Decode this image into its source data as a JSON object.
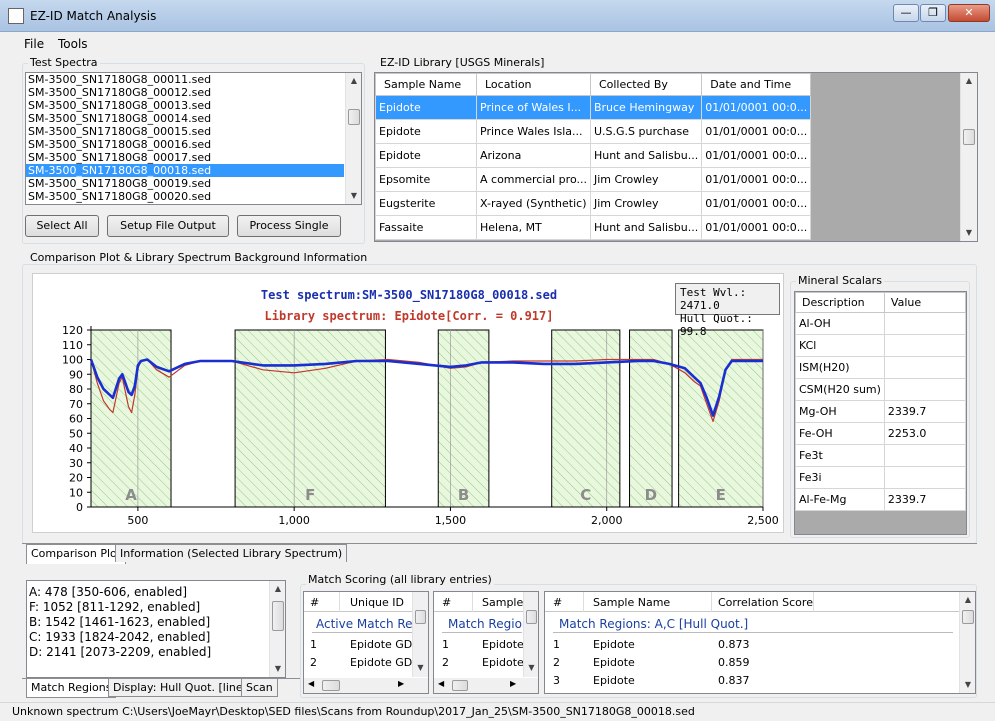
{
  "window": {
    "title": "EZ-ID Match Analysis",
    "min": "—",
    "max": "❐",
    "close": "✕"
  },
  "menu": [
    "File",
    "Tools"
  ],
  "test_spectra": {
    "label": "Test Spectra",
    "items": [
      "SM-3500_SN17180G8_00011.sed",
      "SM-3500_SN17180G8_00012.sed",
      "SM-3500_SN17180G8_00013.sed",
      "SM-3500_SN17180G8_00014.sed",
      "SM-3500_SN17180G8_00015.sed",
      "SM-3500_SN17180G8_00016.sed",
      "SM-3500_SN17180G8_00017.sed",
      "SM-3500_SN17180G8_00018.sed",
      "SM-3500_SN17180G8_00019.sed",
      "SM-3500_SN17180G8_00020.sed"
    ],
    "selected_index": 7,
    "buttons": {
      "select_all": "Select All",
      "setup": "Setup File Output",
      "process": "Process Single"
    }
  },
  "library": {
    "label": "EZ-ID Library [USGS Minerals]",
    "columns": [
      "Sample Name",
      "Location",
      "Collected By",
      "Date and Time"
    ],
    "rows": [
      [
        "Epidote",
        "Prince of Wales I...",
        "Bruce Hemingway",
        "01/01/0001 00:0..."
      ],
      [
        "Epidote",
        "Prince Wales Isla...",
        "U.S.G.S purchase",
        "01/01/0001 00:0..."
      ],
      [
        "Epidote",
        "Arizona",
        "Hunt and Salisbu...",
        "01/01/0001 00:0..."
      ],
      [
        "Epsomite",
        "A commercial pro...",
        "Jim Crowley",
        "01/01/0001 00:0..."
      ],
      [
        "Eugsterite",
        "X-rayed (Synthetic)",
        "Jim Crowley",
        "01/01/0001 00:0..."
      ],
      [
        "Fassaite",
        "Helena, MT",
        "Hunt and Salisbu...",
        "01/01/0001 00:0..."
      ]
    ],
    "selected_row": 0
  },
  "comparison": {
    "label": "Comparison Plot & Library Spectrum Background Information",
    "test_title": "Test spectrum:SM-3500_SN17180G8_00018.sed",
    "lib_title": "Library spectrum: Epidote[Corr. = 0.917]",
    "tooltip_line1": "Test Wvl.: 2471.0",
    "tooltip_line2": "Hull Quot.: 99.8",
    "colors": {
      "test": "#1a2fd0",
      "library": "#c0392b",
      "region_fill": "#e9f7df",
      "hatch": "#8fcf7a"
    }
  },
  "chart_data": {
    "type": "line",
    "title": "Test spectrum:SM-3500_SN17180G8_00018.sed",
    "subtitle": "Library spectrum: Epidote[Corr. = 0.917]",
    "xlim": [
      350,
      2500
    ],
    "ylim": [
      0,
      120
    ],
    "x_ticks": [
      500,
      1000,
      1500,
      2000,
      2500
    ],
    "x_tick_labels": [
      "500",
      "1,000",
      "1,500",
      "2,000",
      "2,500"
    ],
    "y_ticks": [
      0,
      10,
      20,
      30,
      40,
      50,
      60,
      70,
      80,
      90,
      100,
      110,
      120
    ],
    "regions": [
      {
        "name": "A",
        "start": 350,
        "end": 606
      },
      {
        "name": "F",
        "start": 811,
        "end": 1292
      },
      {
        "name": "B",
        "start": 1461,
        "end": 1623
      },
      {
        "name": "C",
        "start": 1824,
        "end": 2042
      },
      {
        "name": "D",
        "start": 2073,
        "end": 2209
      },
      {
        "name": "E",
        "start": 2230,
        "end": 2500
      }
    ],
    "series": [
      {
        "name": "Test spectrum",
        "x": [
          350,
          370,
          390,
          410,
          420,
          440,
          450,
          460,
          470,
          480,
          490,
          500,
          510,
          530,
          560,
          600,
          650,
          700,
          800,
          900,
          1000,
          1100,
          1200,
          1300,
          1400,
          1500,
          1550,
          1600,
          1700,
          1800,
          1900,
          2000,
          2100,
          2150,
          2200,
          2250,
          2280,
          2300,
          2320,
          2340,
          2360,
          2380,
          2400,
          2450,
          2500
        ],
        "y": [
          100,
          88,
          80,
          76,
          74,
          87,
          90,
          84,
          78,
          76,
          82,
          96,
          99,
          100,
          95,
          92,
          97,
          99,
          99,
          96,
          96,
          97,
          99,
          99,
          97,
          95,
          96,
          98,
          98,
          97,
          97,
          98,
          99,
          99,
          97,
          94,
          88,
          84,
          74,
          62,
          75,
          93,
          99,
          99,
          99
        ]
      },
      {
        "name": "Library spectrum",
        "x": [
          350,
          370,
          390,
          410,
          420,
          440,
          450,
          460,
          470,
          480,
          490,
          500,
          510,
          530,
          560,
          600,
          650,
          700,
          800,
          900,
          1000,
          1100,
          1200,
          1300,
          1400,
          1500,
          1550,
          1600,
          1700,
          1800,
          1900,
          2000,
          2100,
          2150,
          2200,
          2250,
          2280,
          2300,
          2320,
          2340,
          2360,
          2380,
          2400,
          2450,
          2500
        ],
        "y": [
          100,
          84,
          72,
          66,
          64,
          84,
          88,
          78,
          68,
          64,
          76,
          94,
          99,
          100,
          93,
          88,
          96,
          99,
          99,
          93,
          91,
          94,
          99,
          100,
          98,
          94,
          95,
          98,
          99,
          99,
          99,
          100,
          100,
          100,
          97,
          91,
          85,
          82,
          70,
          58,
          72,
          93,
          100,
          100,
          100
        ]
      }
    ]
  },
  "scalars": {
    "label": "Mineral Scalars",
    "columns": [
      "Description",
      "Value"
    ],
    "rows": [
      [
        "Al-OH",
        ""
      ],
      [
        "KCl",
        ""
      ],
      [
        "ISM(H20)",
        ""
      ],
      [
        "CSM(H20 sum)",
        ""
      ],
      [
        "Mg-OH",
        "2339.7"
      ],
      [
        "Fe-OH",
        "2253.0"
      ],
      [
        "Fe3t",
        ""
      ],
      [
        "Fe3i",
        ""
      ],
      [
        "Al-Fe-Mg",
        "2339.7"
      ]
    ]
  },
  "plot_tabs": [
    "Comparison Plot",
    "Information (Selected Library Spectrum)"
  ],
  "regions_list": [
    "A: 478 [350-606, enabled]",
    "F: 1052 [811-1292, enabled]",
    "B: 1542 [1461-1623, enabled]",
    "C: 1933 [1824-2042, enabled]",
    "D: 2141 [2073-2209, enabled]"
  ],
  "bottom_tabs": [
    "Match Regions",
    "Display: Hull Quot. [linear]",
    "Scan"
  ],
  "match_scoring": {
    "label": "Match Scoring (all library entries)",
    "grid1": {
      "cols": [
        "#",
        "Unique ID"
      ],
      "group": "Active Match Reg",
      "rows": [
        [
          "1",
          "Epidote GDS"
        ],
        [
          "2",
          "Epidote GDS"
        ]
      ]
    },
    "grid2": {
      "cols": [
        "#",
        "Sample"
      ],
      "group": "Match Region",
      "rows": [
        [
          "1",
          "Epidote"
        ],
        [
          "2",
          "Epidote"
        ]
      ]
    },
    "grid3": {
      "cols": [
        "#",
        "Sample Name",
        "Correlation Score"
      ],
      "group": "Match Regions: A,C [Hull Quot.]",
      "rows": [
        [
          "1",
          "Epidote",
          "0.873"
        ],
        [
          "2",
          "Epidote",
          "0.859"
        ],
        [
          "3",
          "Epidote",
          "0.837"
        ]
      ]
    }
  },
  "status": "Unknown spectrum C:\\Users\\JoeMayr\\Desktop\\SED files\\Scans from Roundup\\2017_Jan_25\\SM-3500_SN17180G8_00018.sed"
}
